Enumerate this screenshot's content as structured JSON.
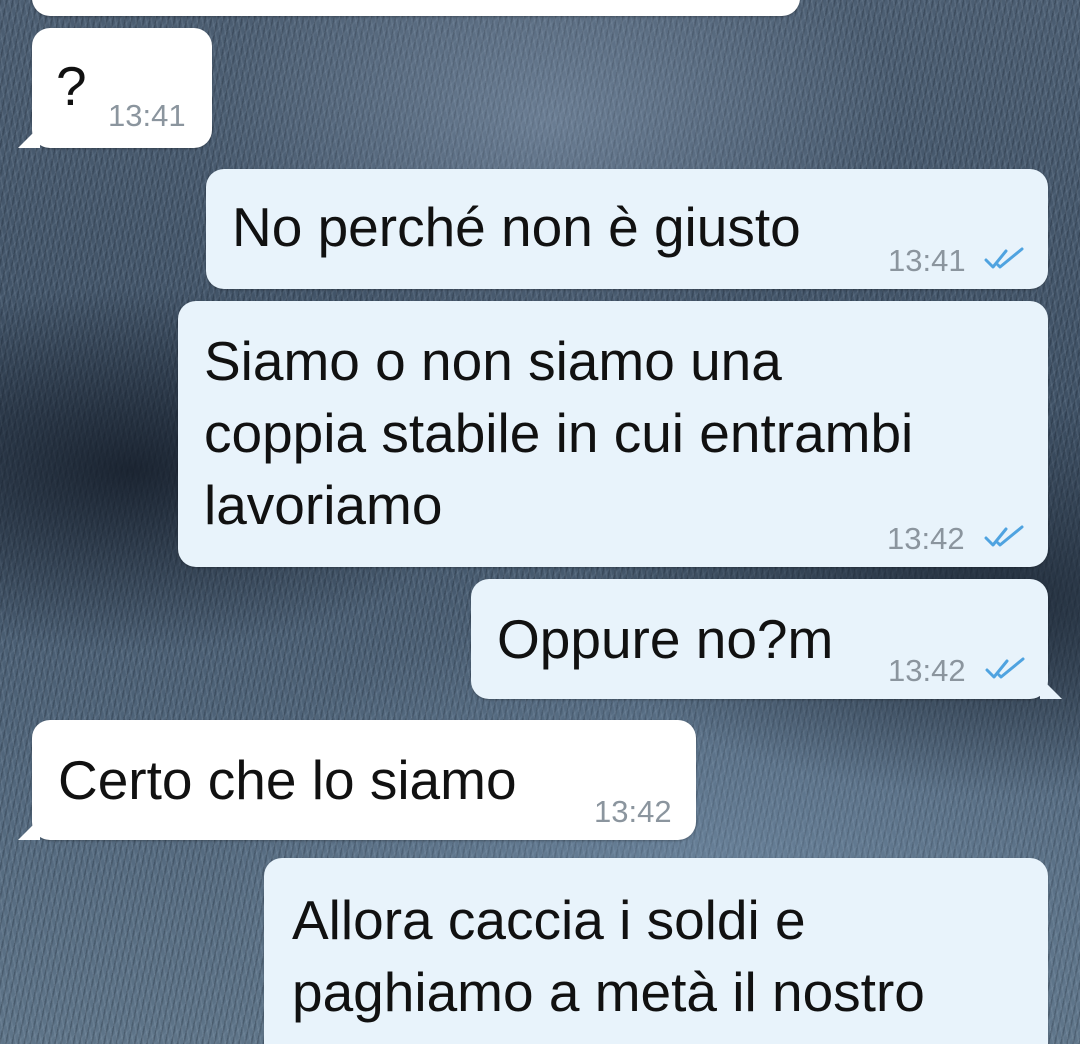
{
  "chat": {
    "messages": [
      {
        "direction": "incoming",
        "text": "?",
        "time": "13:41"
      },
      {
        "direction": "outgoing",
        "text": "No perché non è giusto",
        "time": "13:41",
        "status": "read"
      },
      {
        "direction": "outgoing",
        "text": "Siamo o non siamo una\ncoppia stabile in cui entrambi\nlavoriamo",
        "time": "13:42",
        "status": "read"
      },
      {
        "direction": "outgoing",
        "text": "Oppure no?m",
        "time": "13:42",
        "status": "read"
      },
      {
        "direction": "incoming",
        "text": "Certo che lo siamo",
        "time": "13:42"
      },
      {
        "direction": "outgoing",
        "text": "Allora caccia i soldi e\npaghiamo a metà il nostro",
        "time": "",
        "status": ""
      }
    ]
  },
  "colors": {
    "incoming_bubble": "#ffffff",
    "outgoing_bubble": "#e8f3fb",
    "read_ticks": "#4fa3e0",
    "timestamp": "#8b959e"
  },
  "icons": {
    "read_receipt": "double-check-icon"
  }
}
